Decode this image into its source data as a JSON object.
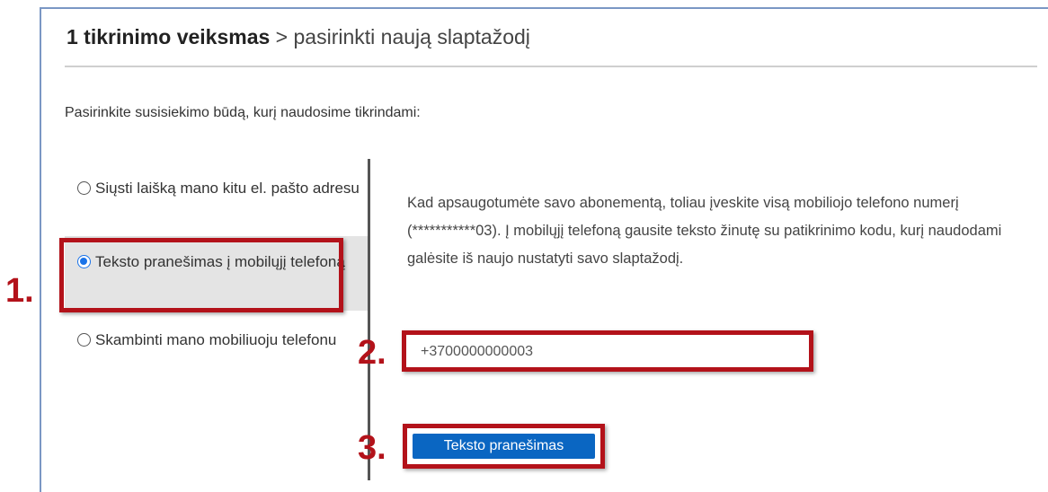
{
  "header": {
    "title_bold": "1 tikrinimo veiksmas",
    "title_rest": " > pasirinkti naują slaptažodį"
  },
  "intro": "Pasirinkite susisiekimo būdą, kurį naudosime tikrindami:",
  "options": [
    {
      "label": "Siųsti laišką mano kitu el. pašto adresu",
      "checked": false
    },
    {
      "label": "Teksto pranešimas į mobilųjį telefoną",
      "checked": true
    },
    {
      "label": "Skambinti mano mobiliuoju telefonu",
      "checked": false
    }
  ],
  "description": "Kad apsaugotumėte savo abonementą, toliau įveskite visą mobiliojo telefono numerį (***********03). Į mobilųjį telefoną gausite teksto žinutę su patikrinimo kodu, kurį naudodami galėsite iš naujo nustatyti savo slaptažodį.",
  "phone_input": {
    "value": "+3700000000003"
  },
  "submit_button": "Teksto pranešimas",
  "annotations": {
    "step1": "1.",
    "step2": "2.",
    "step3": "3."
  },
  "colors": {
    "accent": "#0a66c2",
    "highlight": "#b3121a",
    "selected_bg": "#e4e4e4"
  }
}
